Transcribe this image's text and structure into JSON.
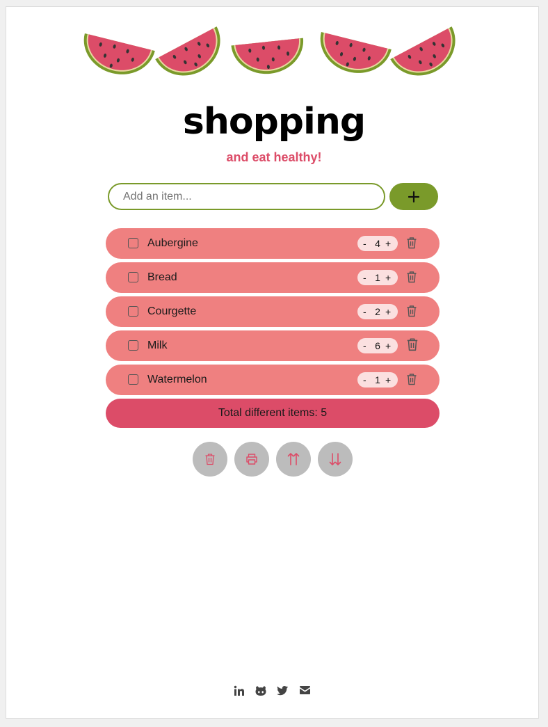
{
  "header": {
    "title": "shopping",
    "subtitle": "and eat healthy!"
  },
  "add_form": {
    "placeholder": "Add an item...",
    "value": "",
    "add_button_icon": "plus-icon"
  },
  "items": [
    {
      "name": "Aubergine",
      "quantity": "4",
      "checked": false
    },
    {
      "name": "Bread",
      "quantity": "1",
      "checked": false
    },
    {
      "name": "Courgette",
      "quantity": "2",
      "checked": false
    },
    {
      "name": "Milk",
      "quantity": "6",
      "checked": false
    },
    {
      "name": "Watermelon",
      "quantity": "1",
      "checked": false
    }
  ],
  "qty_controls": {
    "minus": "-",
    "plus": "+"
  },
  "total": "Total different items: 5",
  "actions": [
    {
      "name": "clear-all",
      "icon": "trash-icon"
    },
    {
      "name": "print",
      "icon": "printer-icon"
    },
    {
      "name": "sort-ascending",
      "icon": "sort-up-icon"
    },
    {
      "name": "sort-descending",
      "icon": "sort-down-icon"
    }
  ],
  "footer_links": [
    {
      "name": "linkedin",
      "icon": "linkedin-icon"
    },
    {
      "name": "github",
      "icon": "github-icon"
    },
    {
      "name": "twitter",
      "icon": "twitter-icon"
    },
    {
      "name": "email",
      "icon": "envelope-icon"
    }
  ],
  "colors": {
    "accent_green": "#7a9a2a",
    "item_background": "#ef8080",
    "total_background": "#dc4c68",
    "subtitle": "#dc4c68",
    "action_button": "#bcbcbc"
  }
}
